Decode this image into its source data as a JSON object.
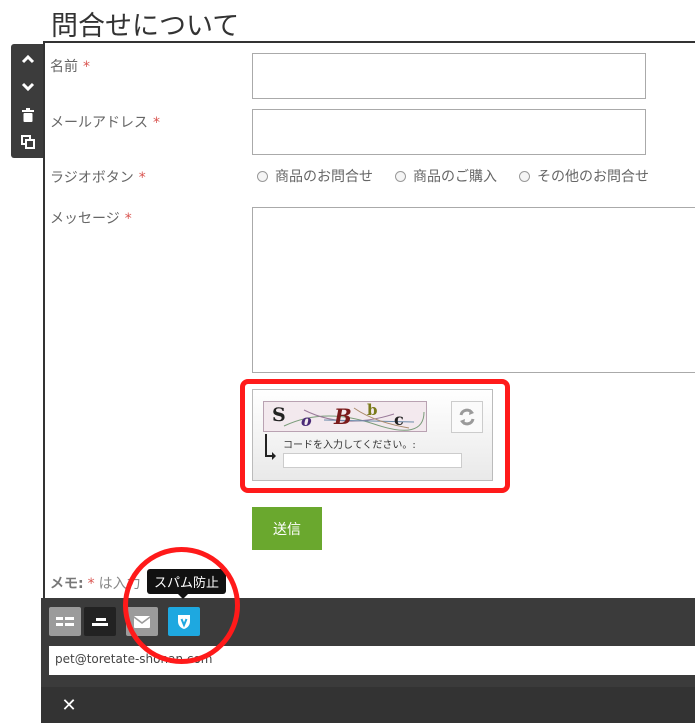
{
  "page_title": "問合せについて",
  "form": {
    "name_label": "名前",
    "email_label": "メールアドレス",
    "radio_label": "ラジオボタン",
    "radio_options": [
      "商品のお問合せ",
      "商品のご購入",
      "その他のお問合せ"
    ],
    "message_label": "メッセージ",
    "required_mark": "*"
  },
  "captcha": {
    "code_chars": [
      "S",
      "o",
      "B",
      "b",
      "c"
    ],
    "prompt": "コードを入力してください。:"
  },
  "send_label": "送信",
  "memo": {
    "prefix": "メモ:",
    "text": "は入力"
  },
  "tooltip": "スパム防止",
  "email_value": "pet@toretate-shonan.com",
  "close_label": "✕",
  "colors": {
    "accent_green": "#6aa82e",
    "highlight_red": "#ff1a1a",
    "toolbar_dark": "#3b3b3b",
    "spam_button_blue": "#1ea8e0"
  }
}
